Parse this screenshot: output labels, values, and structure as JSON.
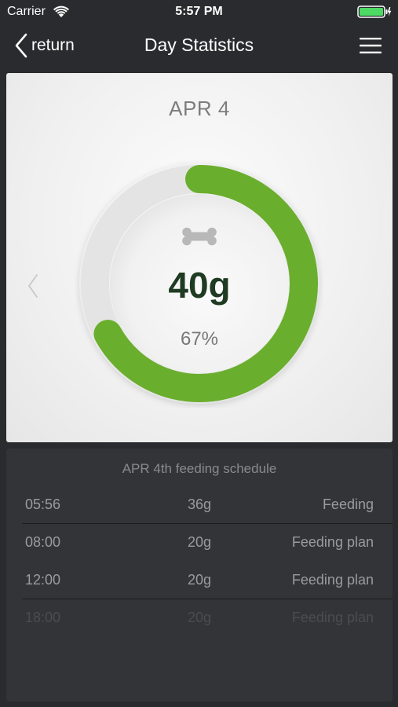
{
  "status_bar": {
    "carrier": "Carrier",
    "time": "5:57 PM"
  },
  "nav": {
    "back_label": "return",
    "title": "Day Statistics"
  },
  "stats": {
    "date": "APR 4",
    "amount": "40g",
    "percent": "67%",
    "progress_fraction": 0.67,
    "ring_color": "#6aae2e"
  },
  "schedule": {
    "title": "APR 4th feeding schedule",
    "rows": [
      {
        "time": "05:56",
        "amount": "36g",
        "type": "Feeding"
      },
      {
        "time": "08:00",
        "amount": "20g",
        "type": "Feeding plan"
      },
      {
        "time": "12:00",
        "amount": "20g",
        "type": "Feeding plan"
      },
      {
        "time": "18:00",
        "amount": "20g",
        "type": "Feeding plan"
      }
    ]
  },
  "colors": {
    "background": "#2a2b2e",
    "accent_green": "#6aae2e",
    "amount_text": "#1f3b22"
  }
}
